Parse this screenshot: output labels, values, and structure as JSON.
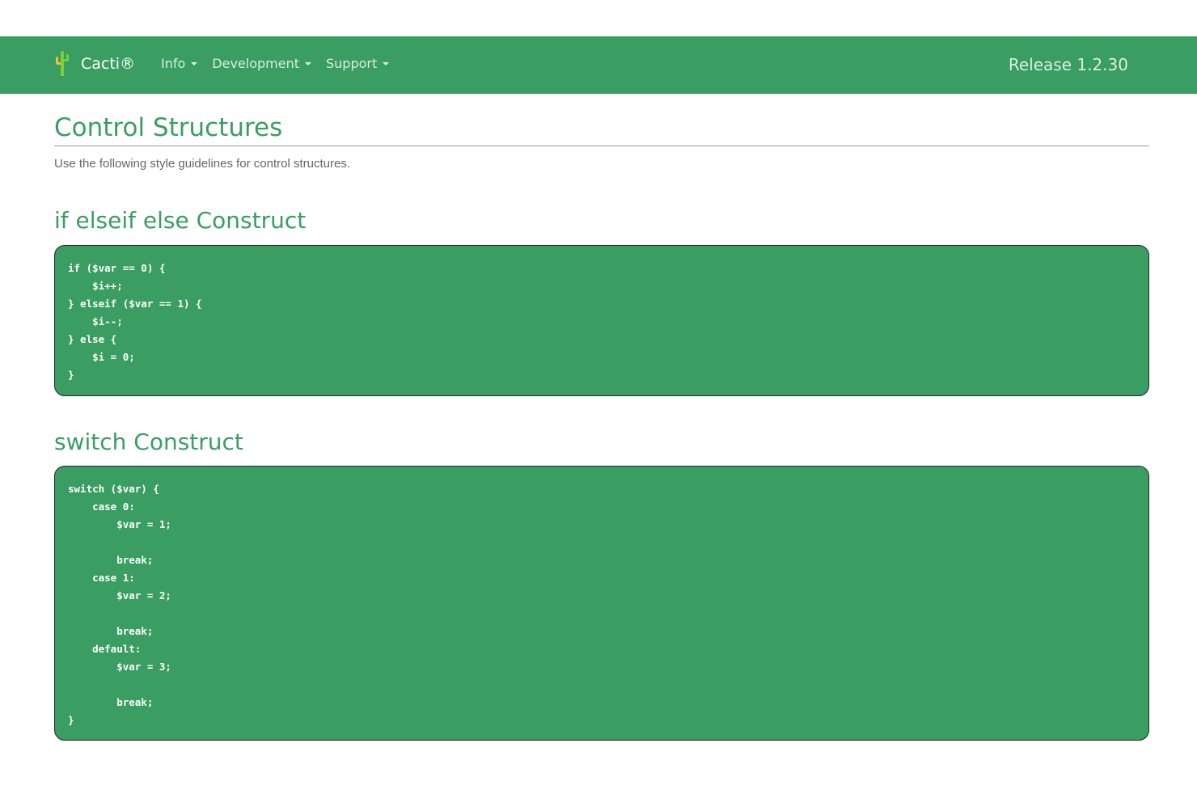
{
  "navbar": {
    "brand": "Cacti®",
    "logo_icon": "cactus-icon",
    "menu": [
      {
        "label": "Info"
      },
      {
        "label": "Development"
      },
      {
        "label": "Support"
      }
    ],
    "release": "Release 1.2.30",
    "bg_color": "#3a9d62"
  },
  "page": {
    "title": "Control Structures",
    "intro": "Use the following style guidelines for control structures."
  },
  "sections": [
    {
      "title": "if elseif else Construct",
      "code": "if ($var == 0) {\n    $i++;\n} elseif ($var == 1) {\n    $i--;\n} else {\n    $i = 0;\n}"
    },
    {
      "title": "switch Construct",
      "code": "switch ($var) {\n    case 0:\n        $var = 1;\n\n        break;\n    case 1:\n        $var = 2;\n\n        break;\n    default:\n        $var = 3;\n\n        break;\n}"
    }
  ]
}
